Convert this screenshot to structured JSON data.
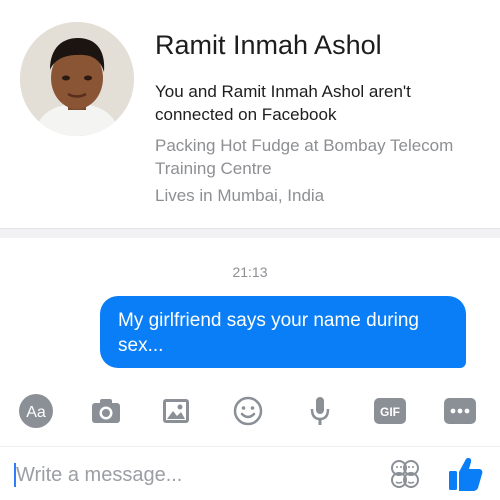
{
  "profile": {
    "name": "Ramit Inmah Ashol",
    "connection": "You and Ramit Inmah Ashol aren't connected on Facebook",
    "work": "Packing Hot Fudge at Bombay Telecom Training Centre",
    "location": "Lives in Mumbai, India"
  },
  "thread": {
    "timestamp": "21:13",
    "messages": [
      {
        "direction": "outgoing",
        "text": "My girlfriend says your name during sex..."
      }
    ]
  },
  "toolbar": {
    "items": [
      {
        "icon": "text-size-icon",
        "label": "Aa"
      },
      {
        "icon": "camera-icon"
      },
      {
        "icon": "gallery-icon"
      },
      {
        "icon": "emoji-icon"
      },
      {
        "icon": "microphone-icon"
      },
      {
        "icon": "gif-icon",
        "label": "GIF"
      },
      {
        "icon": "more-icon"
      }
    ]
  },
  "composer": {
    "placeholder": "Write a message...",
    "emoji_icon": "sticker-icon",
    "send_icon": "like-thumbs-up-icon"
  },
  "colors": {
    "accent": "#0a7ef6",
    "icon": "#8b9097",
    "secondary_text": "#8d8f93"
  }
}
